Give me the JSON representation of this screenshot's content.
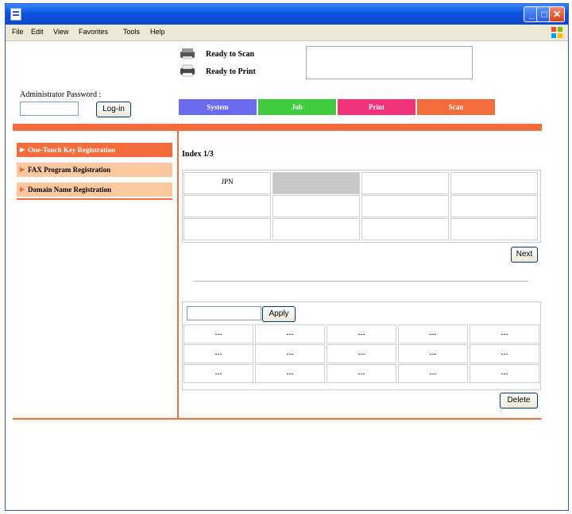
{
  "window": {
    "controls": {
      "minimize": "_",
      "maximize": "□",
      "close": "✕"
    }
  },
  "menubar": {
    "items": [
      "File",
      "Edit",
      "View",
      "Favorites",
      "Tools",
      "Help"
    ]
  },
  "status": {
    "scan": "Ready to Scan",
    "print": "Ready to Print"
  },
  "admin": {
    "label": "Administrator Password :",
    "password_value": "",
    "login_button": "Log-in"
  },
  "tabs": [
    {
      "label": "System",
      "color": "#6b6bf0"
    },
    {
      "label": "Job",
      "color": "#3fcc3f"
    },
    {
      "label": "Print",
      "color": "#f0337a"
    },
    {
      "label": "Scan",
      "color": "#f46c3c"
    }
  ],
  "sidebar": {
    "items": [
      {
        "label": "One-Touch Key Registration",
        "active": true
      },
      {
        "label": "FAX Program Registration",
        "active": false
      },
      {
        "label": "Domain Name Registration",
        "active": false
      }
    ]
  },
  "main": {
    "index_label": "Index 1/3",
    "index_grid": [
      [
        "JPN",
        "",
        "",
        ""
      ],
      [
        "",
        "",
        "",
        ""
      ],
      [
        "",
        "",
        "",
        ""
      ]
    ],
    "next_button": "Next",
    "apply_input_value": "",
    "apply_button": "Apply",
    "entries_grid": [
      [
        "---",
        "---",
        "---",
        "---",
        "---"
      ],
      [
        "---",
        "---",
        "---",
        "---",
        "---"
      ],
      [
        "---",
        "---",
        "---",
        "---",
        "---"
      ]
    ],
    "delete_button": "Delete"
  },
  "colors": {
    "accent": "#f46c3c",
    "sidebar_inactive": "#fbc8a0",
    "selected_cell": "#c8c8c8"
  }
}
